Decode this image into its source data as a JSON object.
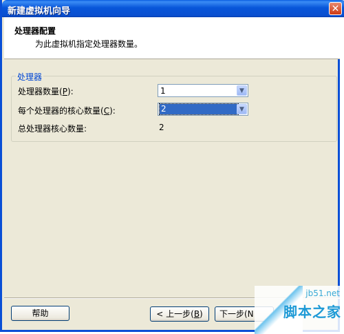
{
  "window": {
    "title": "新建虚拟机向导",
    "close_glyph": "✕"
  },
  "header": {
    "title": "处理器配置",
    "subtitle": "为此虚拟机指定处理器数量。"
  },
  "group": {
    "legend": "处理器",
    "processor_count": {
      "label_pre": "处理器数量(",
      "accesskey": "P",
      "label_post": "):",
      "value": "1"
    },
    "cores_per_processor": {
      "label_pre": "每个处理器的核心数量(",
      "accesskey": "C",
      "label_post": "):",
      "value": "2"
    },
    "total_cores": {
      "label": "总处理器核心数量:",
      "value": "2"
    }
  },
  "footer": {
    "help_label": "帮助",
    "back_label_pre": "< 上一步(",
    "back_accesskey": "B",
    "back_label_post": ")",
    "next_label": "下一步(N"
  },
  "watermark": {
    "top": "jb51.net",
    "main": "脚本之家"
  },
  "icons": {
    "dropdown": "chevron-down-icon",
    "close": "close-icon"
  }
}
